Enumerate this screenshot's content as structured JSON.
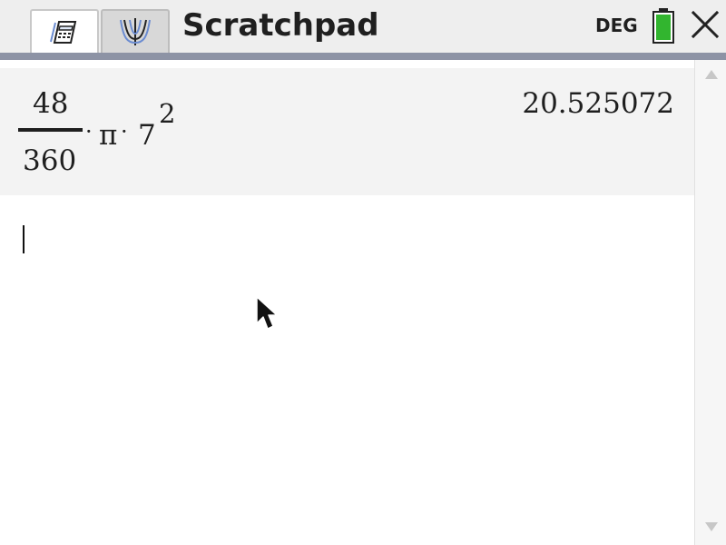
{
  "header": {
    "title": "Scratchpad",
    "angle_mode": "DEG"
  },
  "tabs": [
    {
      "icon": "calculator-icon",
      "active": true
    },
    {
      "icon": "graph-icon",
      "active": false
    }
  ],
  "history": [
    {
      "expression": {
        "numerator": "48",
        "denominator": "360",
        "dot_1": "·",
        "pi": "π",
        "dot_2": "·",
        "base": "7",
        "exponent": "2"
      },
      "result": "20.525072"
    }
  ],
  "input": {
    "value": ""
  },
  "icons": {
    "battery": "battery-icon",
    "close": "close-icon",
    "pointer": "mouse-pointer-icon",
    "scroll_up": "scroll-up-icon",
    "scroll_down": "scroll-down-icon"
  },
  "colors": {
    "battery_fill": "#32b52f",
    "accent_bar": "#8d93a5",
    "history_background": "#f3f3f3"
  }
}
